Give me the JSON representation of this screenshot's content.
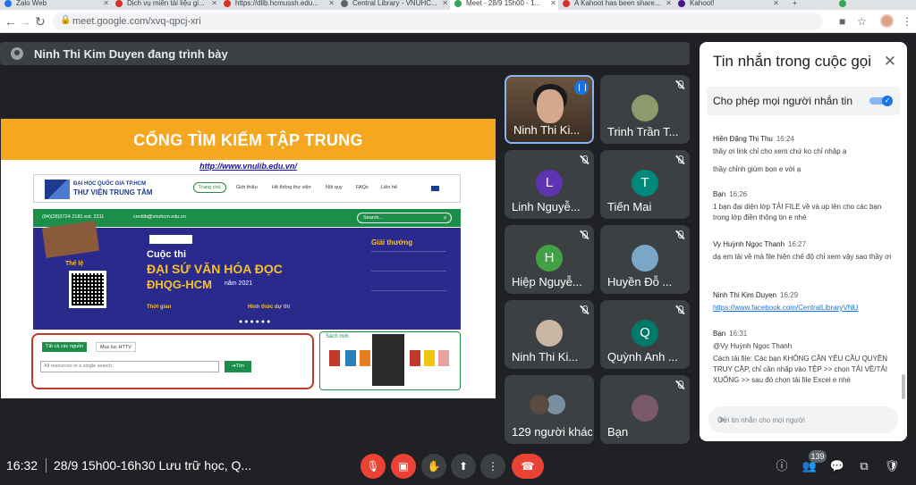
{
  "browser": {
    "tabs": [
      {
        "label": "Zalo Web",
        "color": "#1a73e8"
      },
      {
        "label": "Dịch vụ miễn tài liệu gi...",
        "color": "#d93025"
      },
      {
        "label": "https://dlib.hcmussh.edu...",
        "color": "#d93025"
      },
      {
        "label": "Central Library - VNUHC...",
        "color": "#5f6368"
      },
      {
        "label": "Meet - 28/9 15h00 - 1...",
        "color": "#34a853"
      },
      {
        "label": "A Kahoot has been share...",
        "color": "#d93025"
      },
      {
        "label": "Kahoot!",
        "color": "#46178f"
      }
    ],
    "new_tab": "+",
    "url": "meet.google.com/xvq-qpcj-xri"
  },
  "presenter": {
    "label": "Ninh Thi Kim Duyen đang trình bày"
  },
  "slide": {
    "heading": "CỔNG TÌM KIẾM TẬP TRUNG",
    "link": "http://www.vnulib.edu.vn/",
    "site_title1": "ĐẠI HỌC QUỐC GIA TP.HCM",
    "site_title2": "THƯ VIỆN TRUNG TÂM",
    "nav": [
      "Trang chủ",
      "Giới thiệu",
      "Hệ thống thư viện",
      "Nội quy",
      "FAQs",
      "Liên hệ"
    ],
    "phone": "(84)(28)3724 2181 ext. 2311",
    "email": "centlib@vnuhcm.edu.vn",
    "search": "Search...",
    "banner_cuoc": "Cuộc thi",
    "banner_dai": "ĐẠI SỨ VĂN HÓA ĐỌC",
    "banner_dhqg": "ĐHQG-HCM",
    "banner_nam": "năm 2021",
    "banner_thele": "Thể lệ",
    "banner_thoigian": "Thời gian",
    "banner_hinhthuc": "Hình thức dự thi",
    "banner_giaithuong": "Giải thưởng",
    "lookup_tab1": "Tất cả các nguồn",
    "lookup_tab2": "Mục lục HTTV",
    "lookup_placeholder": "All resources in a single search.",
    "lookup_btn": "➔Tìm",
    "newbooks": "Sách mới"
  },
  "tiles": [
    {
      "name": "Ninh Thi Ki...",
      "avatar": "",
      "color": "#5c4a3a",
      "photo": true,
      "speaking": true
    },
    {
      "name": "Trinh Trần T...",
      "avatar": "",
      "color": "#8d9a6b",
      "photo": true,
      "muted": true
    },
    {
      "name": "Linh Nguyễ...",
      "avatar": "L",
      "color": "#5e35b1",
      "muted": true
    },
    {
      "name": "Tiến Mai",
      "avatar": "T",
      "color": "#00897b",
      "muted": true
    },
    {
      "name": "Hiệp Nguyễ...",
      "avatar": "H",
      "color": "#43a047",
      "muted": true
    },
    {
      "name": "Huyền Đỗ ...",
      "avatar": "",
      "color": "#7aa7c7",
      "photo": true,
      "muted": true
    },
    {
      "name": "Ninh Thi Ki...",
      "avatar": "",
      "color": "#c9b7a4",
      "photo": true,
      "muted": true
    },
    {
      "name": "Quỳnh Anh ...",
      "avatar": "Q",
      "color": "#00796b",
      "muted": true
    },
    {
      "name": "129 người khác",
      "avatar": "",
      "color": "#5a4a40",
      "photo": true
    },
    {
      "name": "Bạn",
      "avatar": "",
      "color": "#7a5a6a",
      "photo": true,
      "muted": true
    }
  ],
  "chat": {
    "title": "Tin nhắn trong cuộc gọi",
    "allow_label": "Cho phép mọi người nhắn tin",
    "messages": [
      {
        "sender": "Hiền Đặng Thị Thu",
        "time": "16:24",
        "lines": [
          "thầy ơi link chỉ cho xem chứ ko chỉ nhập ạ",
          "thầy chỉnh giùm bọn e với ạ"
        ]
      },
      {
        "sender": "Bạn",
        "time": "16:26",
        "lines": [
          "1 bạn đại diện lớp TẢI FILE về và up lên cho các bạn trong lớp điền thông tin e nhé"
        ]
      },
      {
        "sender": "Vy Huỳnh Ngọc Thanh",
        "time": "16:27",
        "lines": [
          "dạ em tải về mà file hiện chế độ chỉ xem vậy sao thầy ơi"
        ]
      },
      {
        "sender": "Ninh Thi Kim Duyen",
        "time": "16:29",
        "link": "https://www.facebook.com/CentralLibraryVNU"
      },
      {
        "sender": "Bạn",
        "time": "16:31",
        "lines": [
          "@Vy Huỳnh Ngọc Thanh",
          "Cách tải file: Các bạn KHÔNG CẦN YÊU CẦU QUYỀN TRUY CẬP, chỉ cần nhấp vào TỆP >> chọn TẢI VỀ/TẢI XUỐNG >> sau đó chọn tải file Excel e nhé"
        ]
      }
    ],
    "input_placeholder": "Gửi tin nhắn cho mọi người"
  },
  "bottom": {
    "time": "16:32",
    "meeting_title": "28/9 15h00-16h30 Lưu trữ học, Q...",
    "participants_count": "139"
  }
}
